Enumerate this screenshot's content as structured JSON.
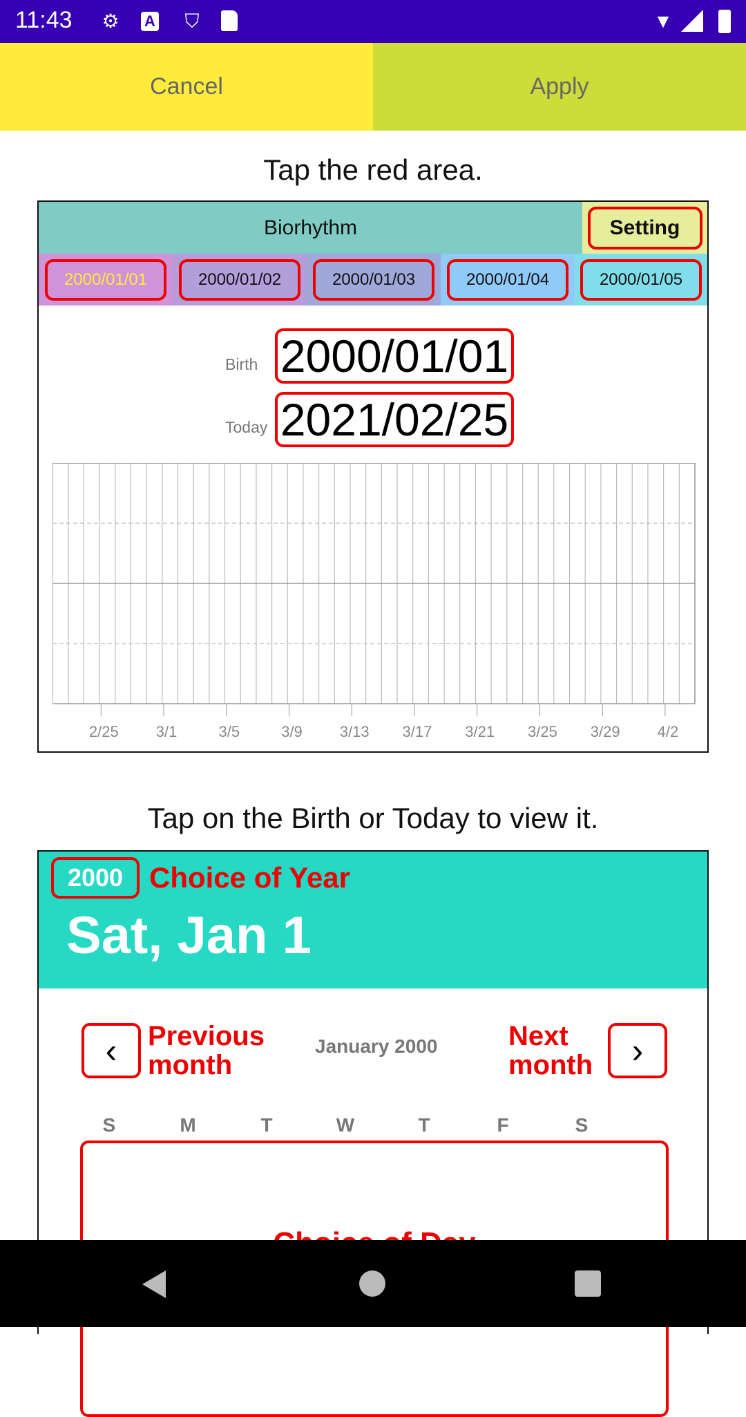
{
  "status_bar": {
    "time": "11:43",
    "icons": [
      "gear-icon",
      "a-icon",
      "play-shield-icon",
      "sd-card-icon"
    ],
    "right_icons": [
      "wifi-icon",
      "signal-icon",
      "battery-icon"
    ]
  },
  "actions": {
    "cancel": "Cancel",
    "apply": "Apply",
    "cancel_color": "#ffeb3b",
    "apply_color": "#cddc39"
  },
  "hint1": "Tap the red area.",
  "app": {
    "title": "Biorhythm",
    "setting": "Setting",
    "tabs": [
      {
        "label": "2000/01/01",
        "color": "#ce93d8",
        "selected": true
      },
      {
        "label": "2000/01/02",
        "color": "#b39ddb"
      },
      {
        "label": "2000/01/03",
        "color": "#9fa8da"
      },
      {
        "label": "2000/01/04",
        "color": "#90caf9"
      },
      {
        "label": "2000/01/05",
        "color": "#80deea"
      }
    ],
    "birth_label": "Birth",
    "birth": "2000/01/01",
    "today_label": "Today",
    "today": "2021/02/25"
  },
  "chart_data": {
    "type": "line",
    "x_ticks": [
      "2/25",
      "3/1",
      "3/5",
      "3/9",
      "3/13",
      "3/17",
      "3/21",
      "3/25",
      "3/29",
      "4/2"
    ],
    "series": [],
    "grid": true
  },
  "hint2": "Tap on the Birth or Today to view it.",
  "picker": {
    "year": "2000",
    "year_note": "Choice of Year",
    "date": "Sat, Jan 1",
    "prev_note": "Previous month",
    "month": "January 2000",
    "next_note": "Next month",
    "weekdays": [
      "S",
      "M",
      "T",
      "W",
      "T",
      "F",
      "S"
    ],
    "day_note": "Choice of Day",
    "header_color": "#26d9c5"
  },
  "nav": {
    "back": "back-icon",
    "home": "home-icon",
    "recents": "recents-icon"
  }
}
